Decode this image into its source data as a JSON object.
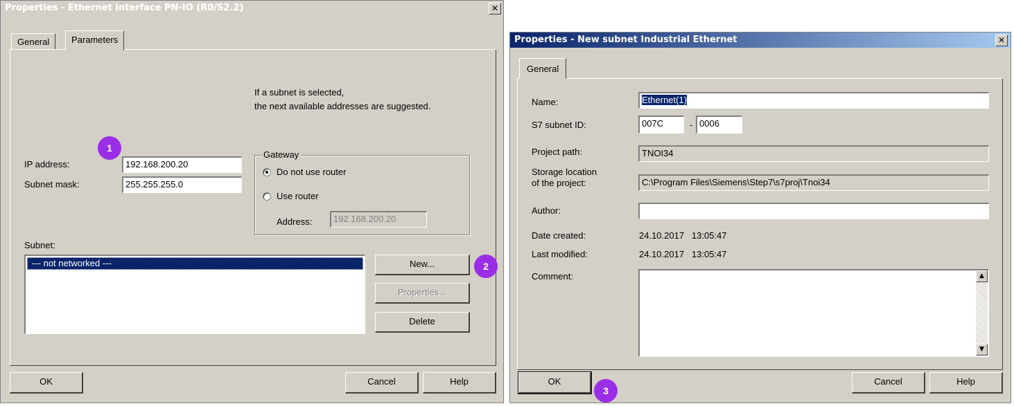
{
  "left_dialog": {
    "title": "Properties - Ethernet interface  PN-IO (R0/S2.2)",
    "tabs": [
      "General",
      "Parameters"
    ],
    "hint_line1": "If a subnet is selected,",
    "hint_line2": "the next available addresses are suggested.",
    "ip_label": "IP address:",
    "ip_value": "192.168.200.20",
    "mask_label": "Subnet mask:",
    "mask_value": "255.255.255.0",
    "gateway": {
      "legend": "Gateway",
      "option1": "Do not use router",
      "option2": "Use router",
      "address_label": "Address:",
      "address_value": "192.168.200.20"
    },
    "subnet_label": "Subnet:",
    "subnet_items": [
      "--- not networked ---"
    ],
    "buttons": {
      "new": "New...",
      "properties": "Properties...",
      "delete": "Delete"
    },
    "footer": {
      "ok": "OK",
      "cancel": "Cancel",
      "help": "Help"
    }
  },
  "right_dialog": {
    "title": "Properties -  New subnet Industrial Ethernet",
    "tabs": [
      "General"
    ],
    "name_label": "Name:",
    "name_value": "Ethernet(1)",
    "subnet_id_label": "S7 subnet ID:",
    "subnet_id_a": "007C",
    "subnet_id_sep": "-",
    "subnet_id_b": "0006",
    "project_path_label": "Project path:",
    "project_path_value": "TNOI34",
    "storage_label_line1": "Storage location",
    "storage_label_line2": "of the project:",
    "storage_value": "C:\\Program Files\\Siemens\\Step7\\s7proj\\Tnoi34",
    "author_label": "Author:",
    "author_value": "",
    "date_created_label": "Date created:",
    "date_created_value": "24.10.2017   13:05:47",
    "last_modified_label": "Last modified:",
    "last_modified_value": "24.10.2017   13:05:47",
    "comment_label": "Comment:",
    "comment_value": "",
    "footer": {
      "ok": "OK",
      "cancel": "Cancel",
      "help": "Help"
    }
  },
  "annotations": [
    "1",
    "2",
    "3"
  ],
  "colors": {
    "dialog_bg": "#d4d0c8",
    "title_gradient_start": "#0a246a",
    "title_gradient_end": "#a6caf0",
    "selection": "#0a246a",
    "badge": "#9a2ee6"
  }
}
